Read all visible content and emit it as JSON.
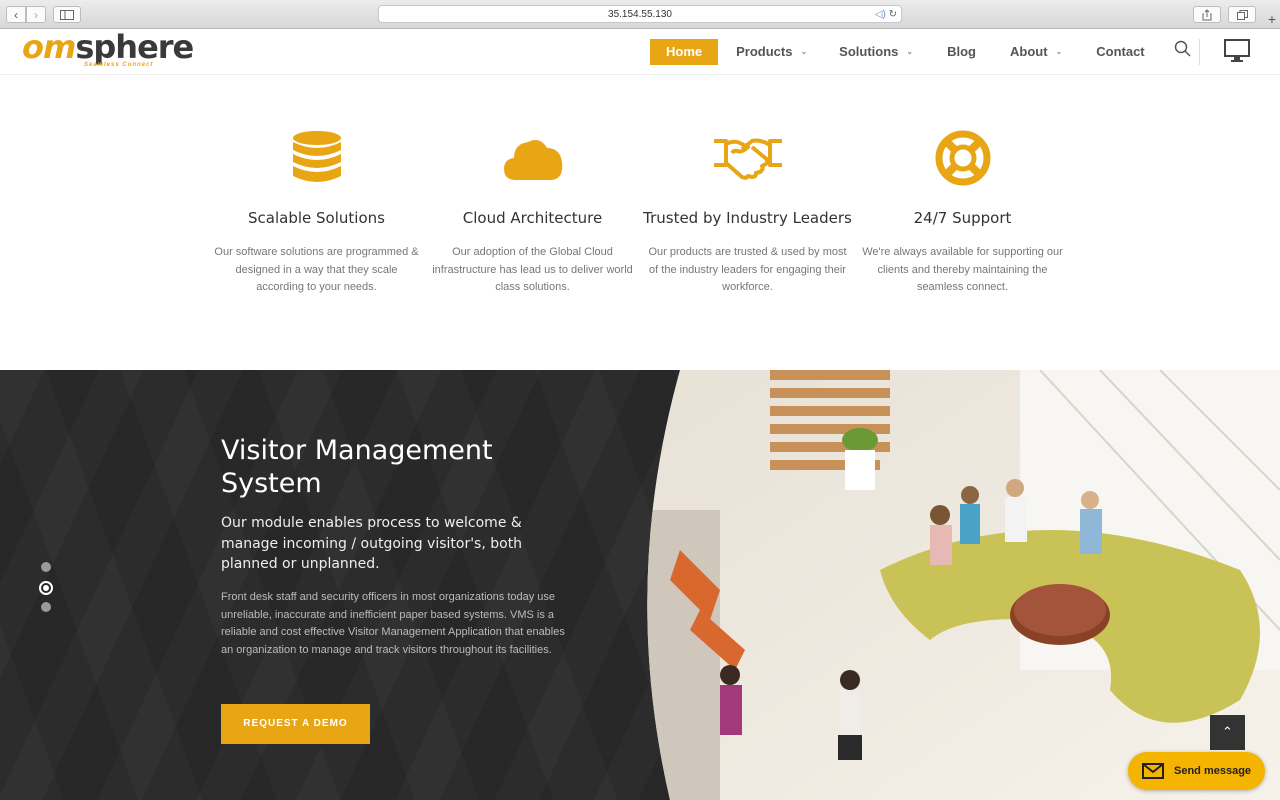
{
  "browser": {
    "url": "35.154.55.130"
  },
  "brand": {
    "logo_part1": "om",
    "logo_part2": "sphere",
    "tagline": "Seamless Connect",
    "accent_color": "#e8a615"
  },
  "nav": {
    "items": [
      {
        "label": "Home",
        "active": true,
        "dropdown": false
      },
      {
        "label": "Products",
        "active": false,
        "dropdown": true
      },
      {
        "label": "Solutions",
        "active": false,
        "dropdown": true
      },
      {
        "label": "Blog",
        "active": false,
        "dropdown": false
      },
      {
        "label": "About",
        "active": false,
        "dropdown": true
      },
      {
        "label": "Contact",
        "active": false,
        "dropdown": false
      }
    ],
    "icons": [
      "search-icon",
      "monitor-icon"
    ]
  },
  "features": [
    {
      "icon": "database-icon",
      "title": "Scalable Solutions",
      "desc": "Our software solutions are programmed & designed in a way that they scale according to your needs."
    },
    {
      "icon": "cloud-icon",
      "title": "Cloud Architecture",
      "desc": "Our adoption of the Global Cloud infrastructure has lead us to deliver world class solutions."
    },
    {
      "icon": "handshake-icon",
      "title": "Trusted by Industry Leaders",
      "desc": "Our products are trusted & used by most of the industry leaders for engaging their workforce."
    },
    {
      "icon": "lifebuoy-icon",
      "title": "24/7 Support",
      "desc": "We're always available for supporting our clients and thereby maintaining the seamless connect."
    }
  ],
  "hero": {
    "title": "Visitor Management System",
    "subtitle": "Our module enables process to welcome & manage incoming / outgoing visitor's, both planned or unplanned.",
    "body": "Front desk staff and security officers in most organizations today use unreliable, inaccurate and inefficient paper based systems. VMS is a reliable and cost effective Visitor Management Application that enables an organization to manage and track visitors throughout its facilities.",
    "cta": "REQUEST A DEMO",
    "slides_total": 3,
    "slide_active": 2
  },
  "widgets": {
    "send_message": "Send message"
  }
}
